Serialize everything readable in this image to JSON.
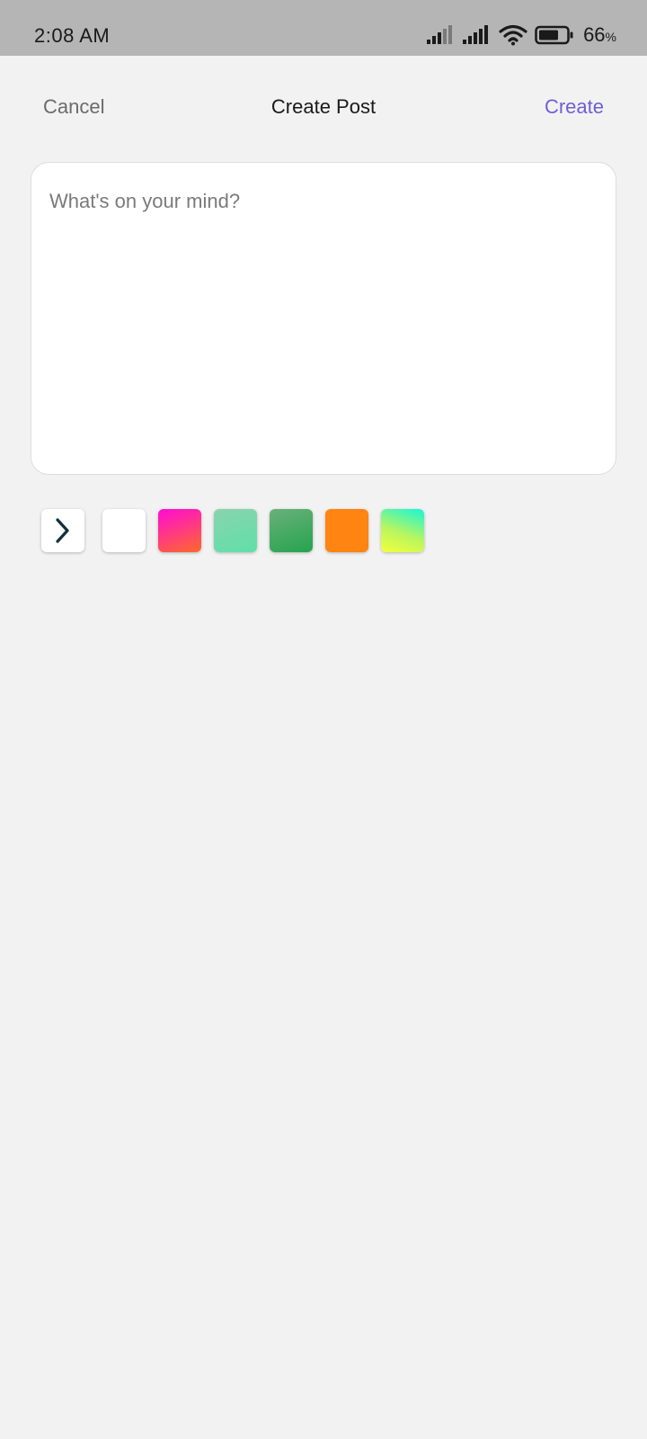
{
  "status_bar": {
    "time": "2:08 AM",
    "battery_level": "66",
    "battery_unit": "%",
    "icons": [
      "signal-icon",
      "signal-icon",
      "wifi-icon",
      "battery-icon"
    ]
  },
  "header": {
    "cancel_label": "Cancel",
    "title": "Create Post",
    "create_label": "Create",
    "create_color": "#6f5fd6"
  },
  "post": {
    "placeholder": "What's on your mind?",
    "value": ""
  },
  "background_options": {
    "expand_icon": "chevron-right-icon",
    "swatches": [
      {
        "name": "white",
        "colors": [
          "#ffffff"
        ]
      },
      {
        "name": "magenta-orange",
        "colors": [
          "#ff0ad6",
          "#ff6a2a"
        ]
      },
      {
        "name": "mint",
        "colors": [
          "#8ad3ae",
          "#5fe0a8"
        ]
      },
      {
        "name": "green",
        "colors": [
          "#6ab07a",
          "#25a44e"
        ]
      },
      {
        "name": "orange",
        "colors": [
          "#ff8412"
        ]
      },
      {
        "name": "cyan-yellow",
        "colors": [
          "#18f6d8",
          "#f4ff3a"
        ]
      }
    ]
  }
}
